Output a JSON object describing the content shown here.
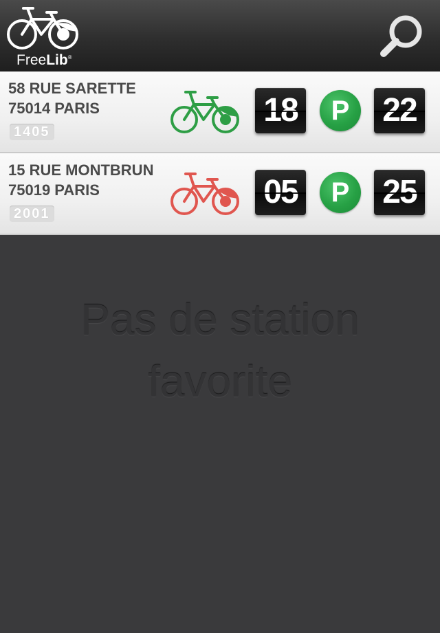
{
  "app": {
    "logo_text_regular": "Free",
    "logo_text_bold": "Lib",
    "logo_reg_mark": "®",
    "search_icon": "search-icon",
    "bike_logo_icon": "bike-logo-icon"
  },
  "colors": {
    "available_green": "#2e9e45",
    "low_red": "#e0564f",
    "parking_green": "#27a145"
  },
  "stations": [
    {
      "address_line1": "58 RUE SARETTE",
      "address_line2": "75014 PARIS",
      "station_number": "1405",
      "bike_icon": "bike-green-icon",
      "bikes_available": "18",
      "parking_label": "P",
      "docks_available": "22"
    },
    {
      "address_line1": "15 RUE MONTBRUN",
      "address_line2": "75019 PARIS",
      "station_number": "2001",
      "bike_icon": "bike-red-icon",
      "bikes_available": "05",
      "parking_label": "P",
      "docks_available": "25"
    }
  ],
  "empty_state": {
    "line1": "Pas de station",
    "line2": "favorite"
  }
}
